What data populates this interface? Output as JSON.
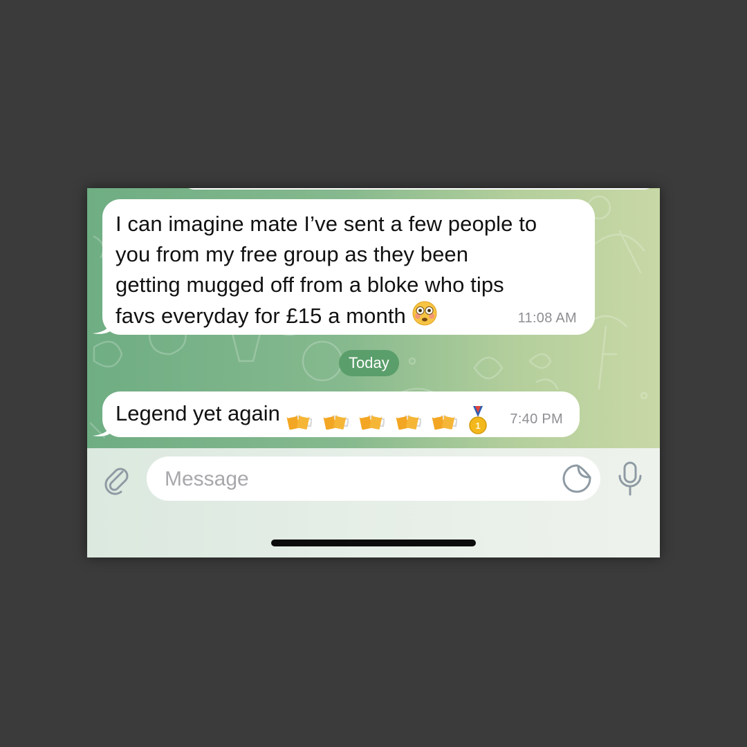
{
  "messages": [
    {
      "text": "I can imagine mate I’ve sent a few people to\nyou from my free group as they been\ngetting mugged off from a bloke who tips\nfavs everyday for £15 a month",
      "emoji": "flushed-face",
      "time": "11:08 AM"
    },
    {
      "text": "Legend yet again",
      "emoji": [
        "beer-mugs",
        "beer-mugs",
        "beer-mugs",
        "beer-mugs",
        "beer-mugs",
        "gold-medal"
      ],
      "time": "7:40 PM"
    }
  ],
  "date_separator": "Today",
  "composer": {
    "placeholder": "Message",
    "icons": [
      "paperclip-icon",
      "sticker-icon",
      "microphone-icon"
    ]
  },
  "colors": {
    "background": "#3b3b3b",
    "chat_wallpaper_start": "#6fad83",
    "chat_wallpaper_end": "#c8d8a6",
    "bubble": "#ffffff",
    "date_pill": "#5a9e6b",
    "timestamp": "#8e8e93",
    "icon_gray": "#8e9aa3"
  }
}
